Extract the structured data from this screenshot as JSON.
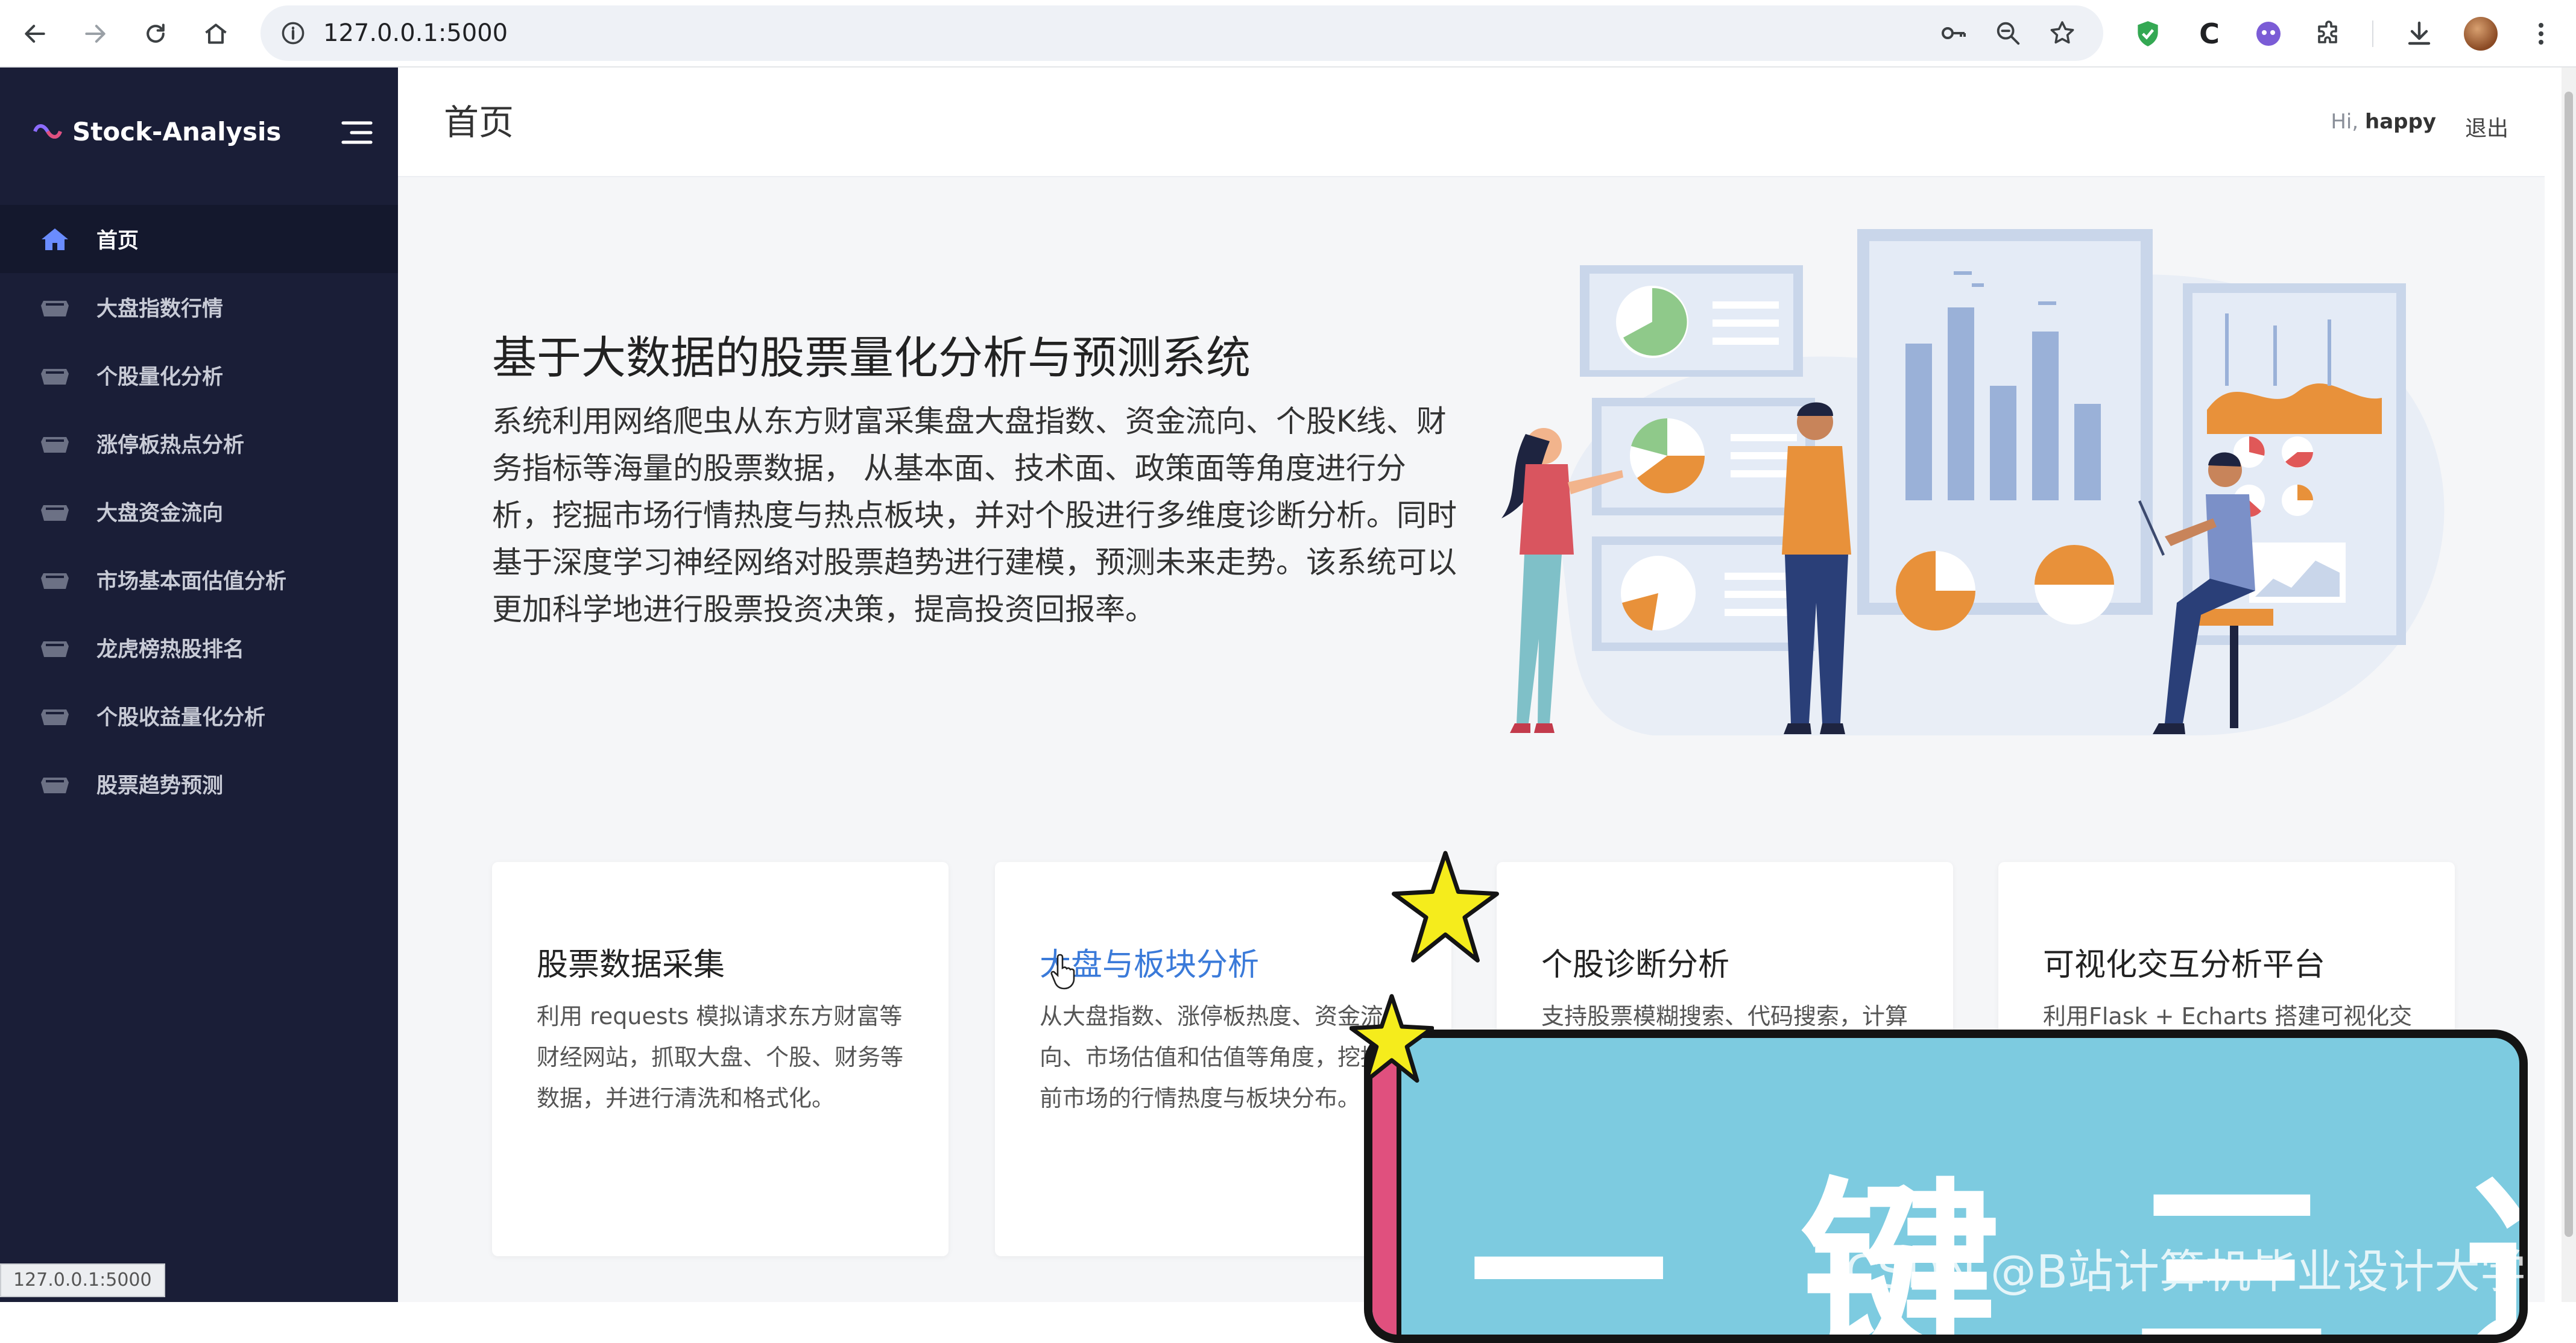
{
  "browser": {
    "url": "127.0.0.1:5000",
    "status_url": "127.0.0.1:5000",
    "nav_icons": [
      "back-icon",
      "forward-icon",
      "reload-icon",
      "home-icon"
    ],
    "omnibox_icons": [
      "key-icon",
      "zoom-icon",
      "star-icon"
    ],
    "toolbar_icons": [
      "shield-extension-icon",
      "c-extension-icon",
      "face-extension-icon",
      "extensions-icon",
      "download-icon",
      "profile-avatar",
      "menu-icon"
    ],
    "extension_c_label": "C"
  },
  "sidebar": {
    "brand": "Stock-Analysis",
    "items": [
      {
        "label": "首页",
        "icon": "home-icon",
        "active": true
      },
      {
        "label": "大盘指数行情",
        "icon": "dashboard-icon",
        "active": false
      },
      {
        "label": "个股量化分析",
        "icon": "dashboard-icon",
        "active": false
      },
      {
        "label": "涨停板热点分析",
        "icon": "dashboard-icon",
        "active": false
      },
      {
        "label": "大盘资金流向",
        "icon": "dashboard-icon",
        "active": false
      },
      {
        "label": "市场基本面估值分析",
        "icon": "dashboard-icon",
        "active": false
      },
      {
        "label": "龙虎榜热股排名",
        "icon": "dashboard-icon",
        "active": false
      },
      {
        "label": "个股收益量化分析",
        "icon": "dashboard-icon",
        "active": false
      },
      {
        "label": "股票趋势预测",
        "icon": "dashboard-icon",
        "active": false
      }
    ]
  },
  "header": {
    "page_title": "首页",
    "greeting": "Hi,",
    "username": "happy",
    "logout": "退出"
  },
  "hero": {
    "title": "基于大数据的股票量化分析与预测系统",
    "description": "系统利用网络爬虫从东方财富采集盘大盘指数、资金流向、个股K线、财务指标等海量的股票数据， 从基本面、技术面、政策面等角度进行分析，挖掘市场行情热度与热点板块，并对个股进行多维度诊断分析。同时基于深度学习神经网络对股票趋势进行建模，预测未来走势。该系统可以更加科学地进行股票投资决策，提高投资回报率。"
  },
  "cards": [
    {
      "title": "股票数据采集",
      "desc": "利用 requests 模拟请求东方财富等财经网站，抓取大盘、个股、财务等数据，并进行清洗和格式化。",
      "link": false
    },
    {
      "title": "大盘与板块分析",
      "desc": "从大盘指数、涨停板热度、资金流向、市场估值和估值等角度，挖掘当前市场的行情热度与板块分布。",
      "link": true
    },
    {
      "title": "个股诊断分析",
      "desc": "支持股票模糊搜索、代码搜索，计算",
      "link": false
    },
    {
      "title": "可视化交互分析平台",
      "desc": "利用Flask + Echarts 搭建可视化交",
      "link": false
    }
  ],
  "overlay": {
    "promo_text": "一键三连",
    "watermark": "CSDN @B站计算机毕业设计大学"
  },
  "colors": {
    "sidebar_bg": "#1a1e37",
    "accent_blue": "#3a7ad9",
    "illustration_orange": "#e8913a",
    "promo_bg": "#7dcbe0",
    "promo_stripe": "#e0507e",
    "star_yellow": "#f5ec1c"
  }
}
